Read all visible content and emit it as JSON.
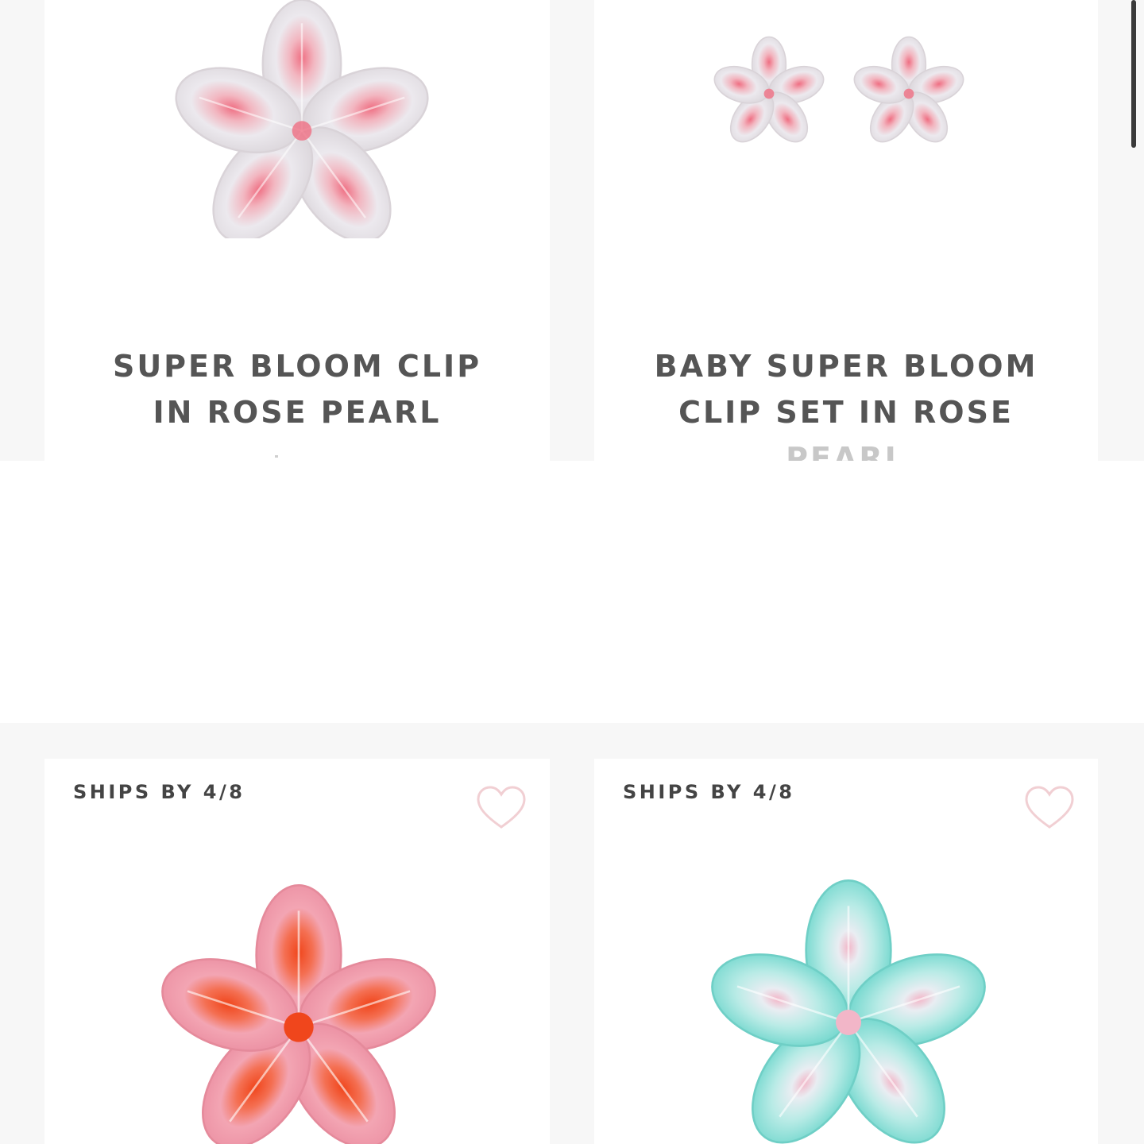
{
  "products": [
    {
      "title_line1": "SUPER BLOOM CLIP",
      "title_line2": "IN ROSE PEARL",
      "palette": {
        "petal": "#ece9ee",
        "center": "#ef6f83"
      }
    },
    {
      "title_line1": "BABY SUPER BLOOM",
      "title_line2": "CLIP SET IN ROSE",
      "title_line3": "PEARL",
      "palette": {
        "petal": "#ece9ee",
        "center": "#ef6f83"
      }
    },
    {
      "badge": "SHIPS BY 4/8",
      "palette": {
        "petal": "#f3a5b3",
        "center": "#f0461c"
      }
    },
    {
      "badge": "SHIPS BY 4/8",
      "palette": {
        "petal": "#9fe1dc",
        "center": "#f2b6c8"
      }
    }
  ],
  "icons": {
    "wishlist": "heart-icon"
  },
  "colors": {
    "heart_outline": "#f1cfd3",
    "title_text": "#555555",
    "badge_text": "#444444",
    "page_bg": "#f7f7f7",
    "card_bg": "#ffffff"
  }
}
